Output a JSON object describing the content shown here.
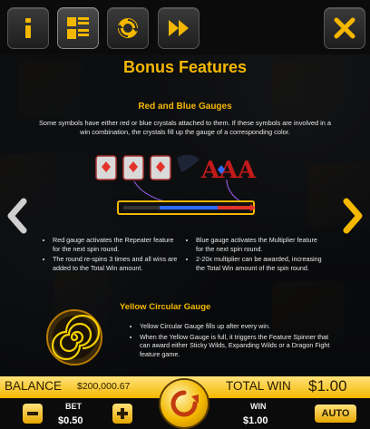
{
  "toolbar": {
    "buttons": [
      {
        "name": "info",
        "icon": "info-icon"
      },
      {
        "name": "paytable",
        "icon": "paytable-icon"
      },
      {
        "name": "settings",
        "icon": "refresh-icon"
      },
      {
        "name": "turbo",
        "icon": "fast-forward-icon"
      },
      {
        "name": "close",
        "icon": "close-icon"
      }
    ]
  },
  "content": {
    "title": "Bonus Features",
    "section1_title": "Red and Blue Gauges",
    "section1_intro": "Some symbols have either red or blue crystals attached to them. If these symbols are involved in a win combination, the crystals fill up the gauge of a corresponding color.",
    "left_bullets": [
      "Red gauge activates the Repeater feature for the next spin round.",
      "The round re-spins 3 times and all wins are added to the Total Win amount."
    ],
    "right_bullets": [
      "Blue gauge activates the Multiplier feature for the next spin round.",
      "2-20x multiplier can be awarded, increasing the Total Win amount of the spin round."
    ],
    "section2_title": "Yellow Circular Gauge",
    "section2_bullets": [
      "Yellow Circular Gauge fills up after every win.",
      "When the Yellow Gauge is full, it triggers the Feature Spinner that can award either Sticky Wilds, Expanding Wilds or a Dragon Fight feature game."
    ]
  },
  "bottom": {
    "balance_label": "BALANCE",
    "balance_value": "$200,000.67",
    "total_win_label": "TOTAL WIN",
    "total_win_value": "$1.00",
    "bet_label": "BET",
    "bet_value": "$0.50",
    "win_label": "WIN",
    "win_value": "$1.00",
    "auto_label": "AUTO"
  },
  "colors": {
    "accent": "#f6b800",
    "red_gauge": "#e2332b",
    "blue_gauge": "#2e6bff",
    "yellow_strip": "#f4b800"
  }
}
